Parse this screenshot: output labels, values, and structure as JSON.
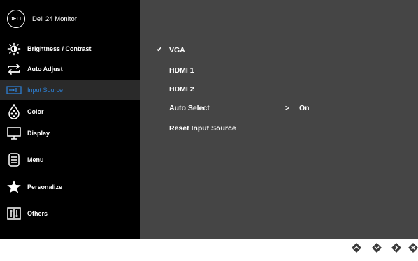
{
  "window": {
    "title": "Dell 24 Monitor",
    "logo_text": "DELL"
  },
  "sidebar": {
    "items": [
      {
        "label": "Brightness / Contrast",
        "icon": "brightness-icon"
      },
      {
        "label": "Auto Adjust",
        "icon": "auto-adjust-icon"
      },
      {
        "label": "Input Source",
        "icon": "input-source-icon",
        "selected": true
      },
      {
        "label": "Color",
        "icon": "color-icon"
      },
      {
        "label": "Display",
        "icon": "display-icon"
      },
      {
        "label": "Menu",
        "icon": "menu-icon"
      },
      {
        "label": "Personalize",
        "icon": "star-icon"
      },
      {
        "label": "Others",
        "icon": "others-icon"
      }
    ]
  },
  "main": {
    "options": [
      {
        "label": "VGA",
        "checked": true,
        "check_mark": "✔"
      },
      {
        "label": "HDMI 1"
      },
      {
        "label": "HDMI 2"
      },
      {
        "label": "Auto Select",
        "arrow": ">",
        "value": "On"
      },
      {
        "label": "Reset Input Source"
      }
    ]
  },
  "buttons": [
    {
      "name": "up-button",
      "icon": "chevron-up-icon"
    },
    {
      "name": "down-button",
      "icon": "chevron-down-icon"
    },
    {
      "name": "next-button",
      "icon": "chevron-right-icon"
    },
    {
      "name": "close-button",
      "icon": "close-icon"
    }
  ],
  "colors": {
    "sidebar_bg": "#000000",
    "main_bg": "#454545",
    "selected_text": "#2d7fd3",
    "selected_bg": "#2a2a2a",
    "text": "#ffffff",
    "button_fill": "#3a3a3a"
  }
}
